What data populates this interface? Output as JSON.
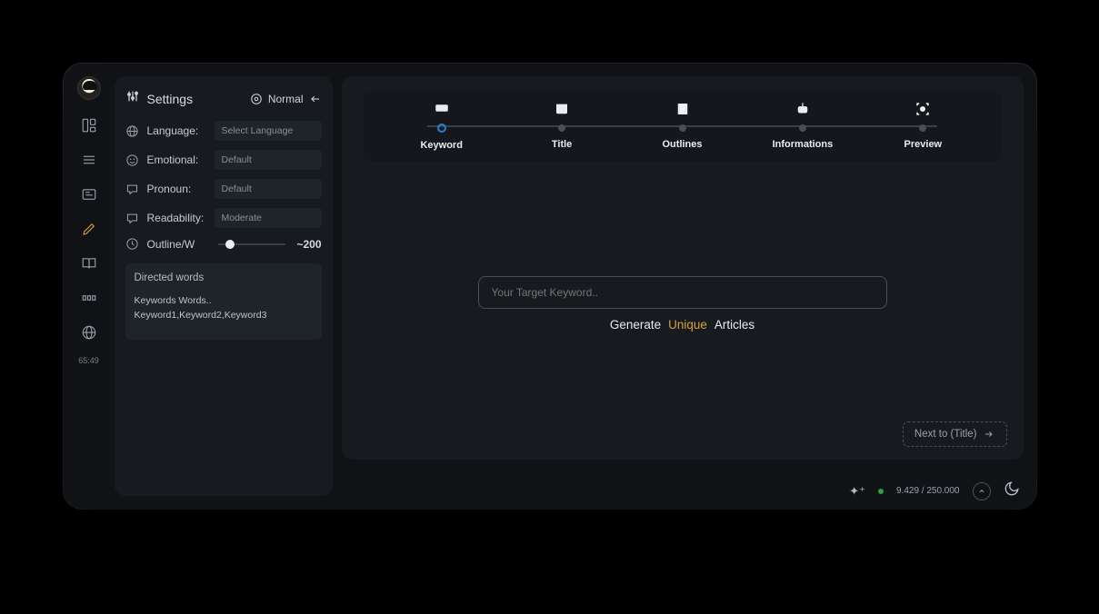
{
  "sidebar": {
    "time": "65:49"
  },
  "settings": {
    "title": "Settings",
    "mode": "Normal",
    "rows": {
      "language": {
        "label": "Language:",
        "value": "Select Language"
      },
      "emotional": {
        "label": "Emotional:",
        "value": "Default"
      },
      "pronoun": {
        "label": "Pronoun:",
        "value": "Default"
      },
      "readability": {
        "label": "Readability:",
        "value": "Moderate"
      },
      "outline": {
        "label": "Outline/W",
        "value": "~200"
      }
    },
    "directed": {
      "title": "Directed words",
      "line1": "Keywords Words..",
      "line2": "Keyword1,Keyword2,Keyword3"
    }
  },
  "stepper": {
    "steps": [
      "Keyword",
      "Title",
      "Outlines",
      "Informations",
      "Preview"
    ]
  },
  "main": {
    "placeholder": "Your Target Keyword..",
    "tag1": "Generate",
    "tag2": "Unique",
    "tag3": "Articles",
    "next": "Next to (Title)"
  },
  "footer": {
    "usage": "9.429 / 250.000"
  }
}
